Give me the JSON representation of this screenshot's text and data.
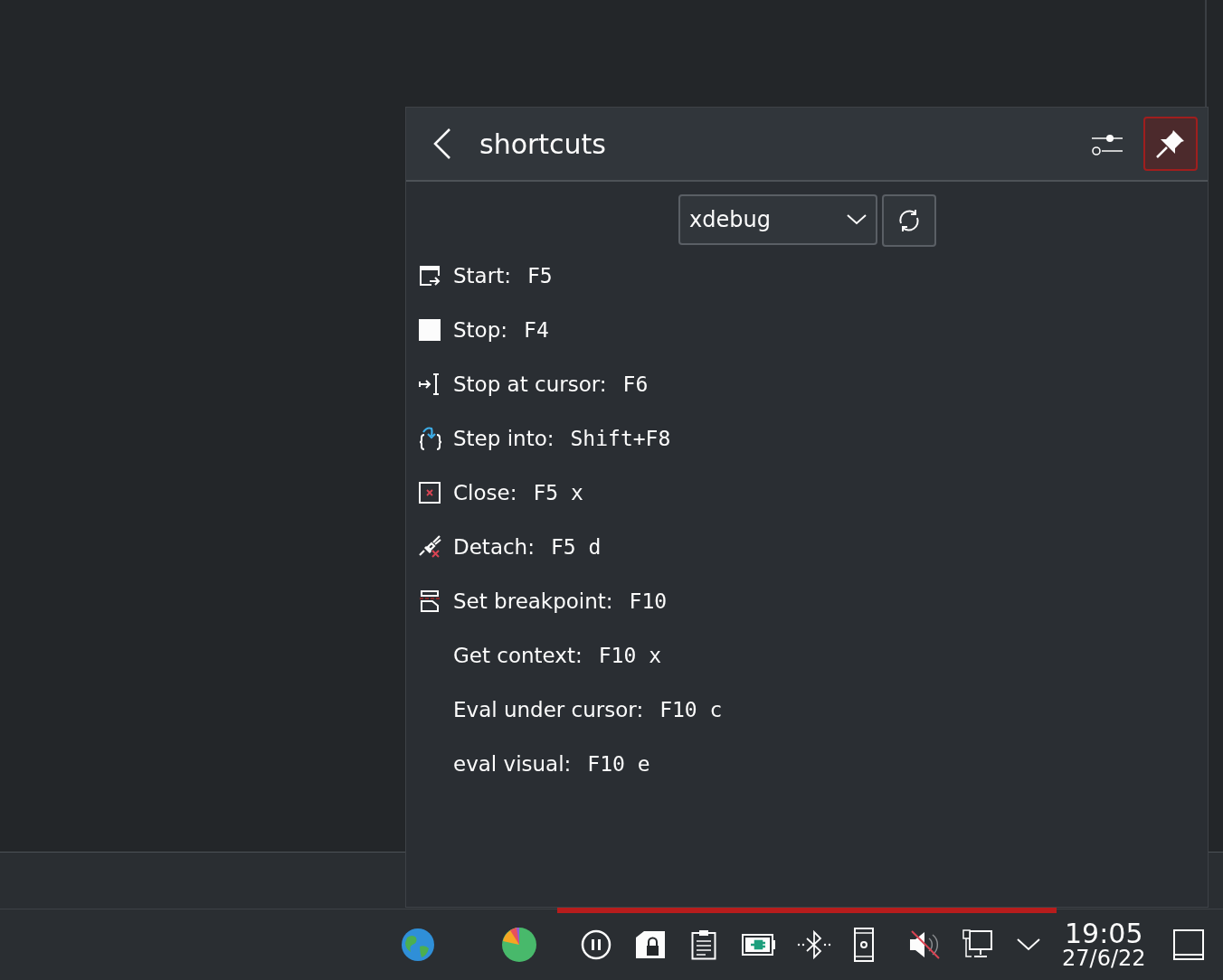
{
  "popup": {
    "title": "shortcuts",
    "pinned": true,
    "profile": {
      "value": "xdebug"
    },
    "shortcuts": [
      {
        "kind": "start",
        "label": "Start:",
        "key": "F5"
      },
      {
        "kind": "stop",
        "label": "Stop:",
        "key": "F4"
      },
      {
        "kind": "cursor",
        "label": "Stop at cursor:",
        "key": "F6"
      },
      {
        "kind": "step",
        "label": "Step into:",
        "key": "Shift+F8"
      },
      {
        "kind": "close",
        "label": "Close:",
        "key": "F5 x"
      },
      {
        "kind": "detach",
        "label": "Detach:",
        "key": "F5 d"
      },
      {
        "kind": "breakpoint",
        "label": "Set breakpoint:",
        "key": "F10"
      },
      {
        "kind": "plain",
        "label": "Get context:",
        "key": "F10 x"
      },
      {
        "kind": "plain",
        "label": "Eval under cursor:",
        "key": "F10 c"
      },
      {
        "kind": "plain",
        "label": "eval visual:",
        "key": "F10 e"
      }
    ]
  },
  "taskbar": {
    "clock": {
      "time": "19:05",
      "date": "27/6/22"
    }
  }
}
